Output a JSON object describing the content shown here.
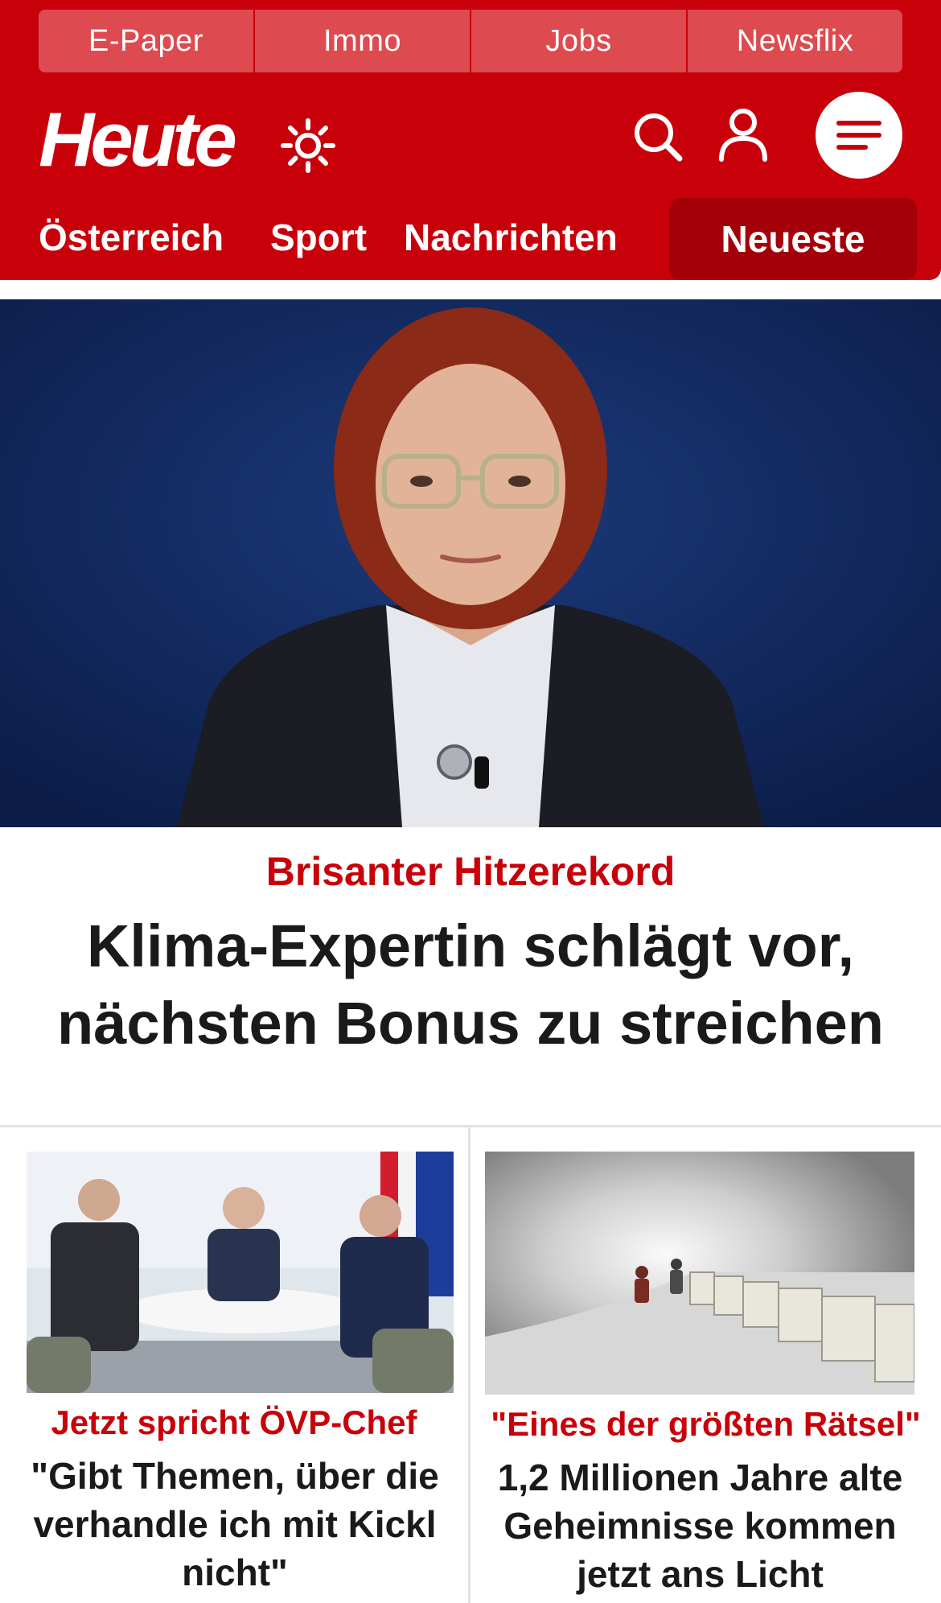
{
  "service_tabs": [
    "E-Paper",
    "Immo",
    "Jobs",
    "Newsflix"
  ],
  "header": {
    "logo_text": "Heute",
    "icons": [
      "sun-icon",
      "search-icon",
      "user-icon",
      "menu-icon"
    ]
  },
  "nav": {
    "items": [
      "Österreich",
      "Sport",
      "Nachrichten"
    ],
    "highlight": "Neueste"
  },
  "hero": {
    "kicker": "Brisanter Hitzerekord",
    "title_line1": "Klima-Expertin schlägt vor,",
    "title_line2": "nächsten Bonus zu streichen"
  },
  "cards": [
    {
      "kicker": "Jetzt spricht ÖVP-Chef",
      "title": "\"Gibt Themen, über die verhandle ich mit Kickl nicht\""
    },
    {
      "kicker": "\"Eines der größten Rätsel\"",
      "title": "1,2 Millionen Jahre alte Geheimnisse kommen jetzt ans Licht"
    }
  ],
  "colors": {
    "brand_red": "#c8000a",
    "tab_red": "#dd4a4f",
    "active_red": "#a3000a",
    "hero_bg": "#13295e"
  }
}
